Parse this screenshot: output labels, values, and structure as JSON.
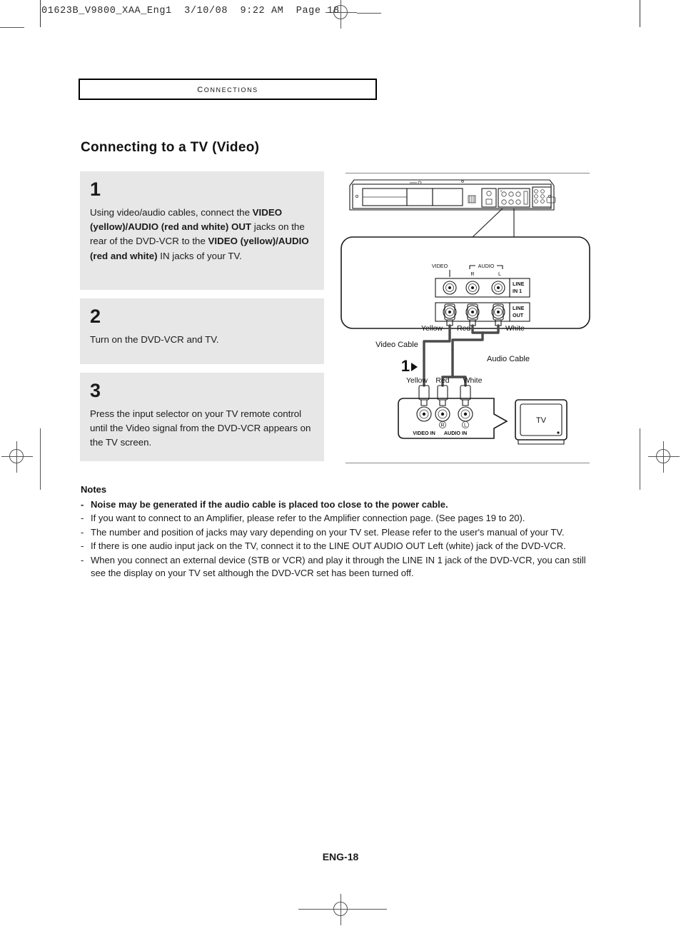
{
  "slug": "01623B_V9800_XAA_Eng1  3/10/08  9:22 AM  Page 18",
  "chapter": "Connections",
  "page_title": "Connecting to a TV (Video)",
  "steps": [
    {
      "number": "1",
      "segments": [
        {
          "text": "Using video/audio cables, connect the ",
          "bold": false
        },
        {
          "text": "VIDEO (yellow)/AUDIO (red and white) OUT",
          "bold": true
        },
        {
          "text": " jacks on the rear of the DVD-VCR to the ",
          "bold": false
        },
        {
          "text": "VIDEO (yellow)/AUDIO (red and white)",
          "bold": true
        },
        {
          "text": " IN jacks of your TV.",
          "bold": false
        }
      ]
    },
    {
      "number": "2",
      "segments": [
        {
          "text": "Turn on the DVD-VCR and TV.",
          "bold": false
        }
      ]
    },
    {
      "number": "3",
      "segments": [
        {
          "text": "Press the input selector on your TV remote control until the Video signal from the DVD-VCR appears on the TV screen.",
          "bold": false
        }
      ]
    }
  ],
  "diagram": {
    "panel_labels": {
      "video": "VIDEO",
      "audio": "AUDIO",
      "audio_r": "R",
      "audio_l": "L",
      "line_in": "LINE\nIN 1",
      "line_in_1": "LINE",
      "line_in_2": "IN 1",
      "line_out_1": "LINE",
      "line_out_2": "OUT"
    },
    "cable_top_labels": {
      "yellow": "Yellow",
      "red": "Red",
      "white": "White"
    },
    "cable_names": {
      "video": "Video Cable",
      "audio": "Audio Cable"
    },
    "step_marker": "1",
    "cable_bottom_labels": {
      "yellow": "Yellow",
      "red": "Red",
      "white": "White"
    },
    "tv_labels": {
      "video_in": "VIDEO IN",
      "audio_in": "AUDIO IN",
      "audio_r": "R",
      "audio_l": "L",
      "tv": "TV"
    },
    "colors": {
      "yellow_plug": "#d4d4d4",
      "red_plug": "#6b6b6b",
      "white_plug": "#ffffff",
      "cable": "#4a4a4a",
      "outline": "#1a1a1a"
    }
  },
  "notes": {
    "title": "Notes",
    "dash": "-",
    "items": [
      {
        "bold": true,
        "text": "Noise may be generated if the audio cable is placed too close to the power cable."
      },
      {
        "bold": false,
        "text": "If you want to connect to an Amplifier, please refer to the Amplifier connection page. (See pages 19 to 20)."
      },
      {
        "bold": false,
        "text": "The number and position of jacks may vary depending on your TV set. Please refer to the user's manual of your TV."
      },
      {
        "bold": false,
        "text": "If there is one audio input jack on the TV, connect it to the LINE OUT AUDIO OUT Left (white) jack of the DVD-VCR."
      },
      {
        "bold": false,
        "text": "When you connect an external device (STB or VCR) and play it through the LINE IN 1 jack of the DVD-VCR, you can still see the display on your TV set although the DVD-VCR set has been turned off."
      }
    ]
  },
  "footer": "ENG-18"
}
